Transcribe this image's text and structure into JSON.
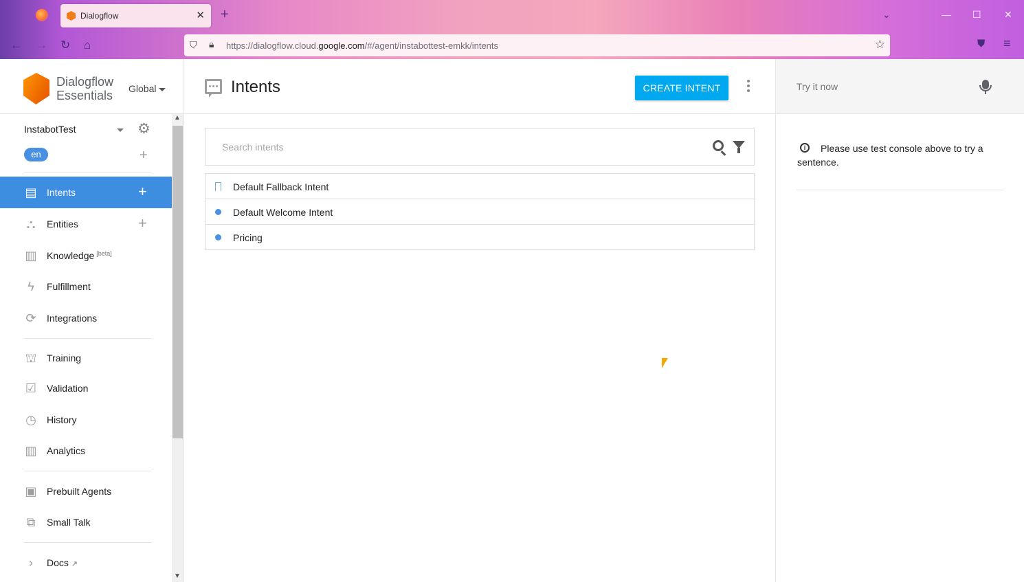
{
  "browser": {
    "tab_title": "Dialogflow",
    "url_prefix": "https://dialogflow.cloud.",
    "url_domain": "google.com",
    "url_suffix": "/#/agent/instabottest-emkk/intents"
  },
  "brand": {
    "name_line1": "Dialogflow",
    "name_line2": "Essentials",
    "region": "Global"
  },
  "agent": {
    "name": "InstabotTest",
    "language": "en"
  },
  "sidebar": {
    "items": [
      {
        "label": "Intents",
        "icon": "chat-icon"
      },
      {
        "label": "Entities",
        "icon": "hierarchy-icon"
      },
      {
        "label": "Knowledge",
        "icon": "book-icon",
        "badge": "[beta]"
      },
      {
        "label": "Fulfillment",
        "icon": "bolt-icon"
      },
      {
        "label": "Integrations",
        "icon": "sync-icon"
      },
      {
        "label": "Training",
        "icon": "graduation-cap-icon"
      },
      {
        "label": "Validation",
        "icon": "check-box-icon"
      },
      {
        "label": "History",
        "icon": "clock-icon"
      },
      {
        "label": "Analytics",
        "icon": "bar-chart-icon"
      },
      {
        "label": "Prebuilt Agents",
        "icon": "bookmark-box-icon"
      },
      {
        "label": "Small Talk",
        "icon": "chat-bubbles-icon"
      },
      {
        "label": "Docs",
        "icon": "external-link-icon"
      }
    ]
  },
  "main": {
    "title": "Intents",
    "create_label": "CREATE INTENT",
    "search_placeholder": "Search intents",
    "intents": [
      {
        "name": "Default Fallback Intent",
        "marker": "flag"
      },
      {
        "name": "Default Welcome Intent",
        "marker": "dot"
      },
      {
        "name": "Pricing",
        "marker": "dot"
      }
    ]
  },
  "console": {
    "placeholder": "Try it now",
    "hint": "Please use test console above to try a sentence."
  },
  "colors": {
    "accent": "#3d8ee0",
    "button": "#00a8f0",
    "dot": "#4a90e2"
  }
}
